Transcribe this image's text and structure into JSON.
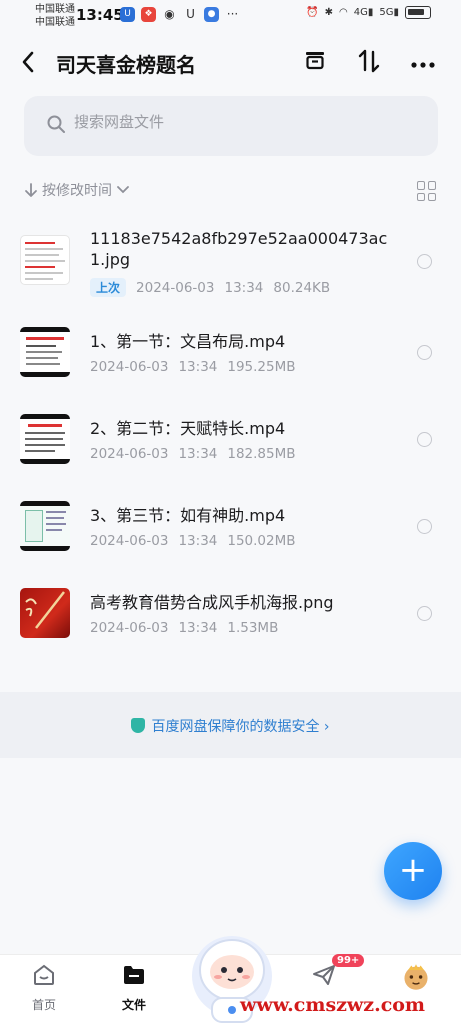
{
  "status_bar": {
    "carrier_1": "中国联通",
    "carrier_2": "中国联通",
    "time": "13:45",
    "signal_1": "4G",
    "signal_2": "5G"
  },
  "header": {
    "title": "司天喜金榜题名"
  },
  "search": {
    "placeholder": "搜索网盘文件"
  },
  "sort": {
    "label": "按修改时间"
  },
  "files": [
    {
      "name": "11183e7542a8fb297e52aa000473ac1.jpg",
      "badge": "上次",
      "date": "2024-06-03",
      "time": "13:34",
      "size": "80.24KB",
      "thumb": "doc"
    },
    {
      "name": "1、第一节：文昌布局.mp4",
      "date": "2024-06-03",
      "time": "13:34",
      "size": "195.25MB",
      "thumb": "video"
    },
    {
      "name": "2、第二节：天赋特长.mp4",
      "date": "2024-06-03",
      "time": "13:34",
      "size": "182.85MB",
      "thumb": "video"
    },
    {
      "name": "3、第三节：如有神助.mp4",
      "date": "2024-06-03",
      "time": "13:34",
      "size": "150.02MB",
      "thumb": "video"
    },
    {
      "name": "高考教育借势合成风手机海报.png",
      "date": "2024-06-03",
      "time": "13:34",
      "size": "1.53MB",
      "thumb": "poster"
    }
  ],
  "safety_banner": {
    "text": "百度网盘保障你的数据安全"
  },
  "bottom_nav": {
    "home": "首页",
    "files": "文件",
    "messages_badge": "99+"
  },
  "watermark": "www.cmszwz.com",
  "colors": {
    "accent": "#1f82f0",
    "banner_text": "#2f7fd0",
    "badge_red": "#f0435a"
  }
}
